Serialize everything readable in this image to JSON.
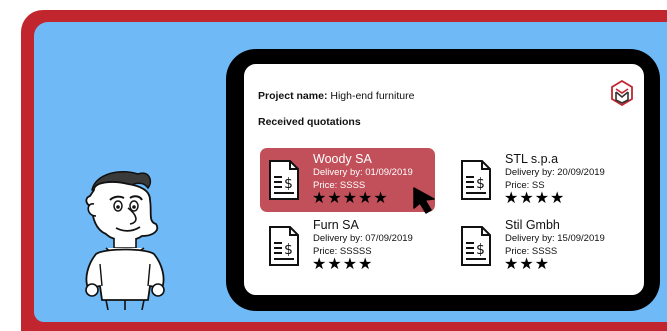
{
  "project": {
    "label": "Project name:",
    "value": "High-end furniture"
  },
  "section_title": "Received quotations",
  "quotations": [
    {
      "name": "Woody SA",
      "delivery": "Delivery by:  01/09/2019",
      "price": "Price: SSSS",
      "stars": "★★★★★",
      "selected": true
    },
    {
      "name": "STL s.p.a",
      "delivery": "Delivery by:  20/09/2019",
      "price": "Price: SS",
      "stars": "★★★★",
      "selected": false
    },
    {
      "name": "Furn SA",
      "delivery": "Delivery by:  07/09/2019",
      "price": "Price: SSSSS",
      "stars": "★★★★",
      "selected": false
    },
    {
      "name": "Stil Gmbh",
      "delivery": "Delivery by: 15/09/2019",
      "price": "Price: SSSS",
      "stars": "★★★",
      "selected": false
    }
  ],
  "colors": {
    "frame": "#c1262f",
    "background": "#6fb9f7",
    "selected_card": "#c1505a",
    "device": "#000000"
  }
}
